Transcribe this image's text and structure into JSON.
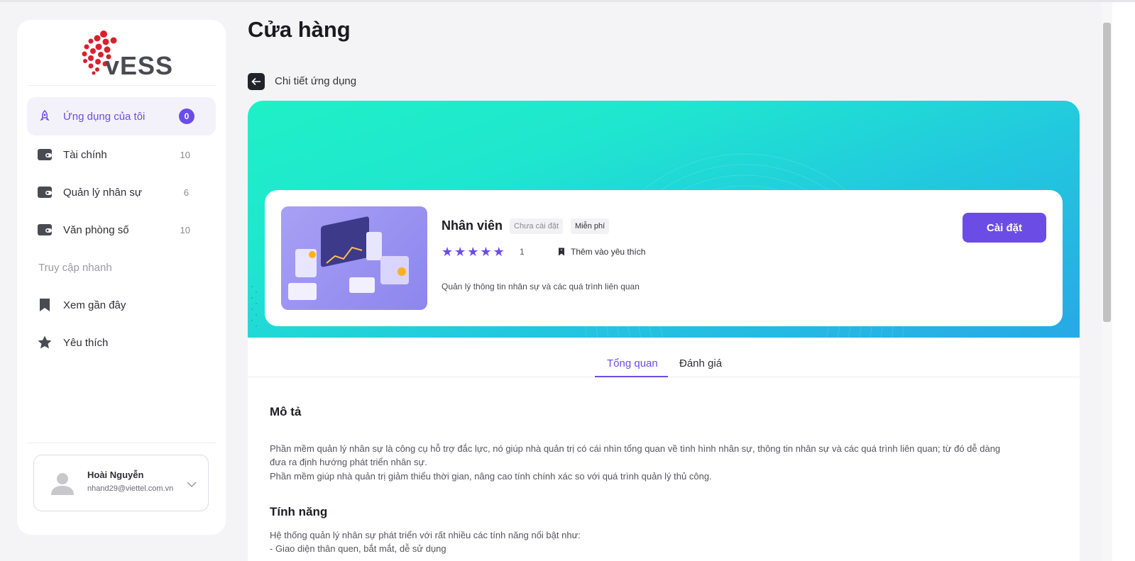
{
  "page": {
    "title": "Cửa hàng"
  },
  "logo": {
    "text": "vESS"
  },
  "sidebar": {
    "items": [
      {
        "label": "Ứng dụng của tôi",
        "count": "0",
        "icon": "rocket-icon",
        "active": true
      },
      {
        "label": "Tài chính",
        "count": "10",
        "icon": "wallet-icon"
      },
      {
        "label": "Quản lý nhân sự",
        "count": "6",
        "icon": "wallet-icon"
      },
      {
        "label": "Văn phòng số",
        "count": "10",
        "icon": "wallet-icon"
      }
    ],
    "quick_access_label": "Truy cập nhanh",
    "quick_items": [
      {
        "label": "Xem gần đây",
        "icon": "bookmark-icon"
      },
      {
        "label": "Yêu thích",
        "icon": "star-icon"
      }
    ],
    "user": {
      "name": "Hoài Nguyễn",
      "email": "nhand29@viettel.com.vn"
    }
  },
  "breadcrumb": {
    "label": "Chi tiết ứng dụng"
  },
  "app": {
    "name": "Nhân viên",
    "status_tag": "Chưa cài đặt",
    "price_tag": "Miễn phí",
    "rating": 5,
    "rating_count": "1",
    "favorite_label": "Thêm vào yêu thích",
    "short_description": "Quản lý thông tin nhân sự và các quá trình liên quan",
    "install_label": "Cài đặt"
  },
  "tabs": {
    "overview": "Tổng quan",
    "reviews": "Đánh giá"
  },
  "details": {
    "desc_heading": "Mô tả",
    "desc_lines": [
      "Phần mềm quản lý nhân sự là công cụ hỗ trợ đắc lực, nó giúp nhà quản trị có cái nhìn tổng quan về tình hình nhân sự, thông tin nhân sự và các quá trình liên quan; từ đó dễ dàng",
      "đưa ra định hướng phát triển nhân sự.",
      "Phần mềm giúp nhà quản trị giảm thiểu thời gian, nâng cao tính chính xác so với quá trình quản lý thủ công."
    ],
    "feat_heading": "Tính năng",
    "feat_lines": [
      "Hệ thống quản lý nhân sự phát triển với rất nhiều các tính năng nổi bật như:",
      "- Giao diện thân quen, bắt mắt, dễ sử dụng"
    ]
  },
  "colors": {
    "accent": "#6b4de6",
    "hero_start": "#1ff0c6",
    "hero_end": "#27a9e6"
  }
}
